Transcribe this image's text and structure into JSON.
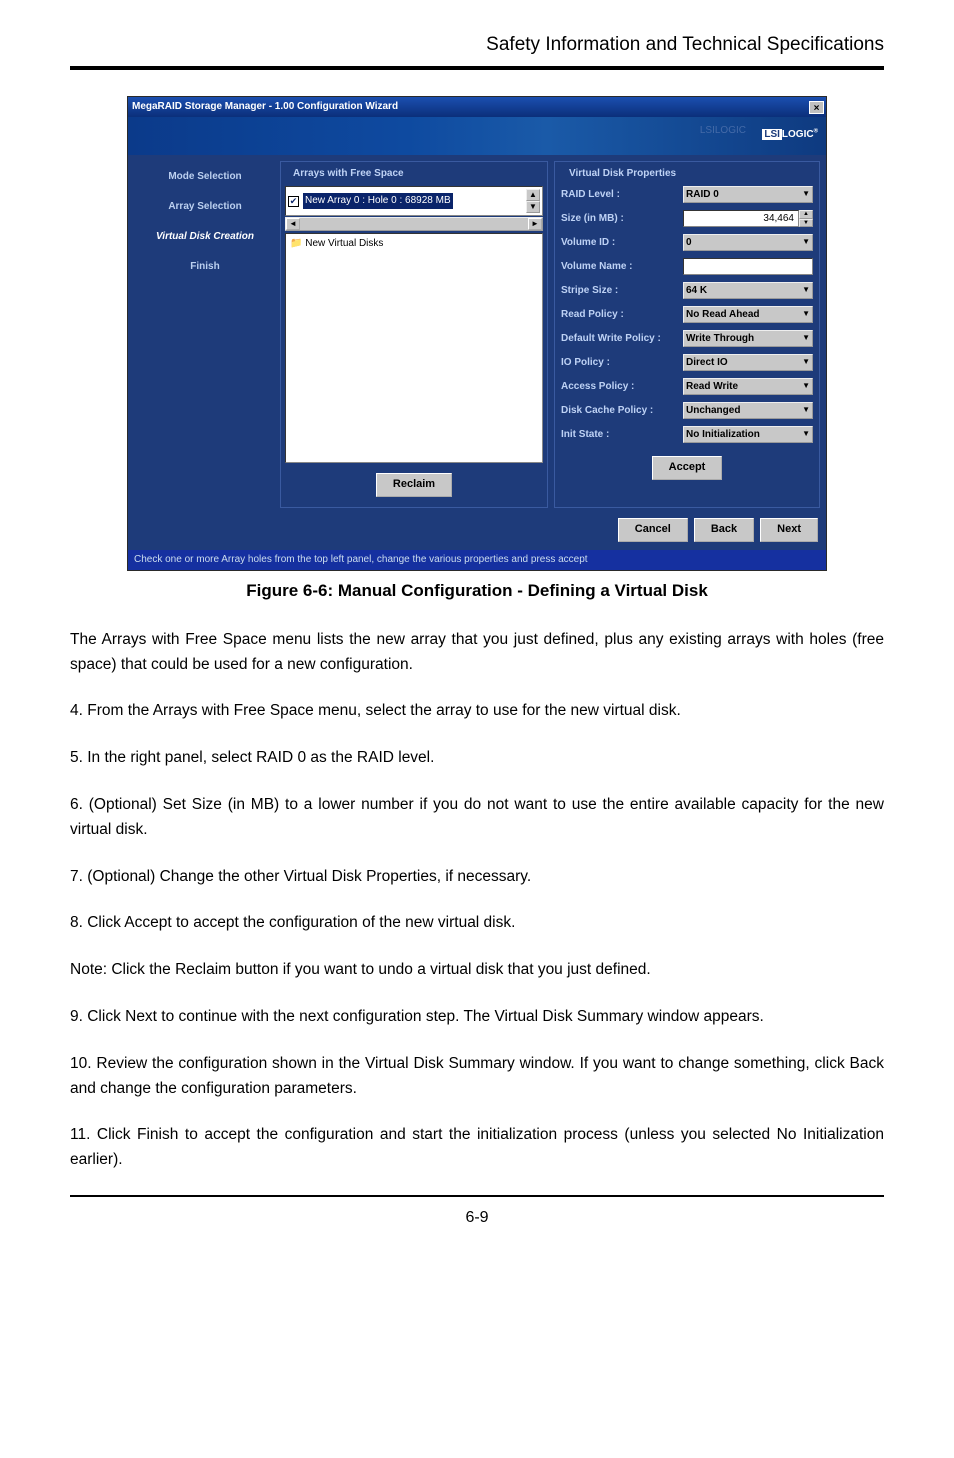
{
  "header": {
    "title": "Safety Information and Technical Specifications"
  },
  "window": {
    "title": "MegaRAID Storage Manager - 1.00 Configuration Wizard",
    "brand_lsi": "LSI",
    "brand_logic": "LOGIC",
    "brand_faded": "LSILOGIC",
    "sidebar": {
      "items": [
        {
          "label": "Mode Selection"
        },
        {
          "label": "Array Selection"
        },
        {
          "label": "Virtual Disk Creation"
        },
        {
          "label": "Finish"
        }
      ]
    },
    "arrays_panel": {
      "title": "Arrays with Free Space",
      "selected_item": "New Array 0 : Hole 0 : 68928 MB",
      "tree_item": "New Virtual Disks",
      "reclaim_label": "Reclaim"
    },
    "vd_panel": {
      "title": "Virtual Disk Properties",
      "rows": {
        "raid_level_label": "RAID Level :",
        "raid_level_value": "RAID 0",
        "size_label": "Size (in MB) :",
        "size_value": "34,464",
        "volume_id_label": "Volume ID :",
        "volume_id_value": "0",
        "volume_name_label": "Volume Name :",
        "volume_name_value": "",
        "stripe_label": "Stripe Size :",
        "stripe_value": "64 K",
        "read_label": "Read Policy :",
        "read_value": "No Read Ahead",
        "write_label": "Default Write Policy :",
        "write_value": "Write Through",
        "io_label": "IO Policy :",
        "io_value": "Direct IO",
        "access_label": "Access Policy :",
        "access_value": "Read Write",
        "cache_label": "Disk Cache Policy :",
        "cache_value": "Unchanged",
        "init_label": "Init State :",
        "init_value": "No Initialization"
      },
      "accept_label": "Accept"
    },
    "buttons": {
      "cancel": "Cancel",
      "back": "Back",
      "next": "Next"
    },
    "status": "Check one or more Array holes from the top left panel, change the various properties and press accept"
  },
  "figure_caption": "Figure 6-6: Manual Configuration - Defining a Virtual Disk",
  "body": {
    "p1": "The Arrays with Free Space menu lists the new array that you just defined, plus any existing arrays with holes (free space) that could be used for a new configuration.",
    "p2": "4. From the Arrays with Free Space menu, select the array to use for the new virtual disk.",
    "p3": "5. In the right panel, select RAID 0 as the RAID level.",
    "p4": "6. (Optional) Set Size (in MB) to a lower number if you do not want to use the entire available capacity for the new virtual disk.",
    "p5": "7. (Optional) Change the other Virtual Disk Properties, if necessary.",
    "p6": "8. Click Accept to accept the configuration of the new virtual disk.",
    "p7": "Note: Click the Reclaim button if you want to undo a virtual disk that you just defined.",
    "p8": "9. Click Next to continue with the next configuration step. The Virtual Disk Summary window appears.",
    "p9": "10. Review the configuration shown in the Virtual Disk Summary window. If you want to change something, click Back and change the configuration parameters.",
    "p10": "11. Click Finish to accept the configuration and start the initialization process (unless you selected No Initialization earlier)."
  },
  "page_number": "6-9"
}
